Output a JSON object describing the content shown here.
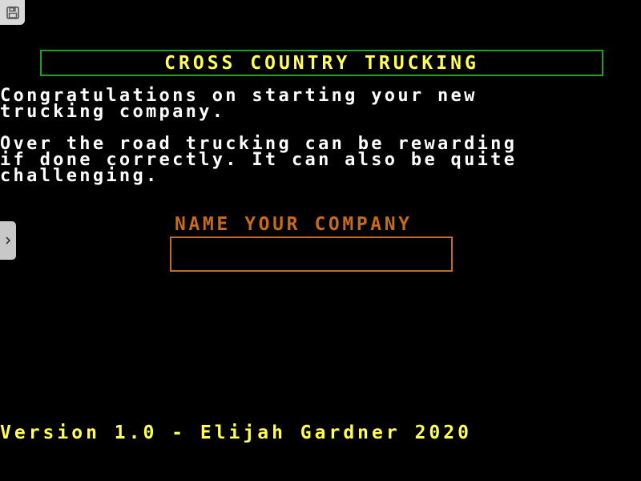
{
  "game": {
    "title": "CROSS COUNTRY TRUCKING",
    "intro_lines": [
      "Congratulations on starting your new",
      "trucking company."
    ],
    "description_lines": [
      "Over the road trucking can be rewarding",
      "if done correctly. It can also be quite",
      "challenging."
    ],
    "name_prompt": "NAME YOUR COMPANY",
    "company_name_value": "",
    "version_text": "Version 1.0 - Elijah Gardner 2020"
  },
  "controls": {
    "save_icon": "floppy-disk-icon",
    "side_toggle_icon": "chevron-right-icon"
  },
  "colors": {
    "background": "#000000",
    "title_border": "#1fa31f",
    "title_text": "#ffff55",
    "body_text": "#ffffff",
    "prompt_accent": "#c66a1c",
    "version_text": "#ffff55"
  }
}
